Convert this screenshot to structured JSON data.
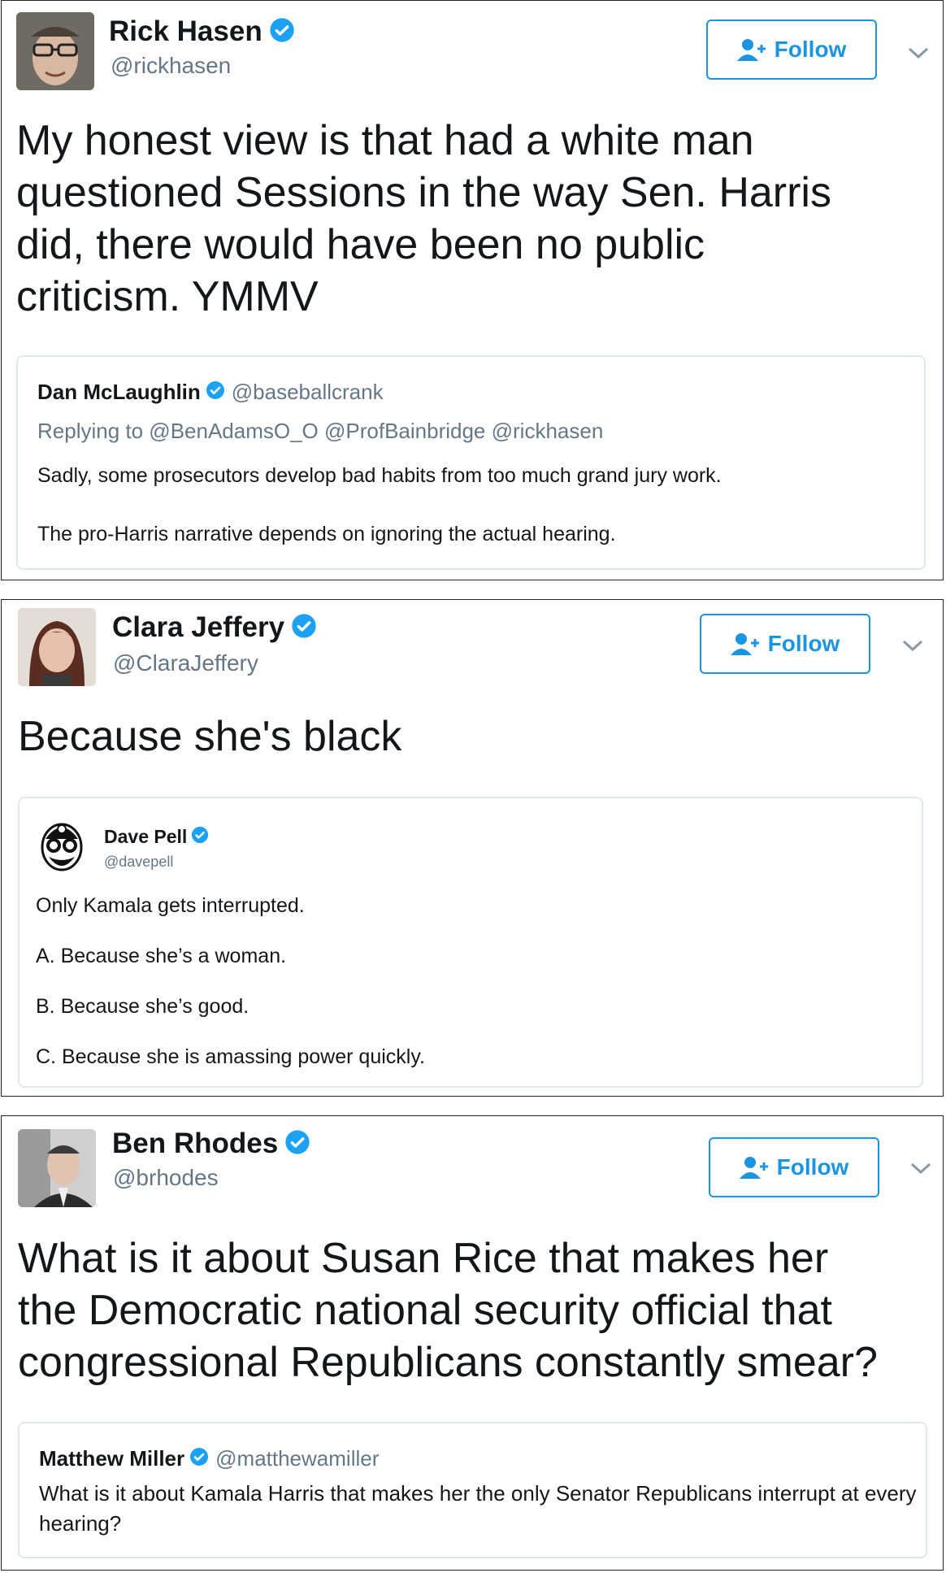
{
  "colors": {
    "accent": "#1b95e0",
    "verified": "#1da1f2",
    "muted": "#657786",
    "text": "#14171a"
  },
  "follow_label": "Follow",
  "tweets": [
    {
      "name": "Rick Hasen",
      "handle": "@rickhasen",
      "text": "My honest view is that had a white man\nquestioned Sessions in the way Sen. Harris\ndid, there would have been no public\ncriticism. YMMV",
      "quote": {
        "name": "Dan McLaughlin",
        "handle": "@baseballcrank",
        "replying": "Replying to @BenAdamsO_O @ProfBainbridge @rickhasen",
        "lines": [
          "Sadly, some prosecutors develop bad habits from too much grand jury work.",
          "The pro-Harris narrative depends on ignoring the actual hearing."
        ]
      }
    },
    {
      "name": "Clara Jeffery",
      "handle": "@ClaraJeffery",
      "text": "Because she's black",
      "quote": {
        "name": "Dave Pell",
        "handle": "@davepell",
        "lines": [
          "Only Kamala gets interrupted.",
          "A. Because she’s a woman.",
          "B. Because she’s good.",
          "C. Because she is amassing power quickly."
        ]
      }
    },
    {
      "name": "Ben Rhodes",
      "handle": "@brhodes",
      "text": "What is it about Susan Rice that makes her\nthe Democratic national security official that\ncongressional Republicans constantly smear?",
      "quote": {
        "name": "Matthew Miller",
        "handle": "@matthewamiller",
        "text": "What is it about Kamala Harris that makes her the only Senator Republicans interrupt at every hearing?"
      }
    }
  ]
}
